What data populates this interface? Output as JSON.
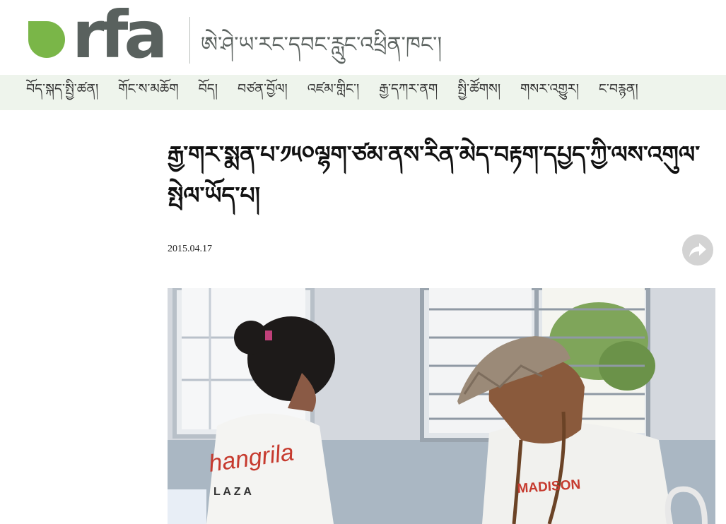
{
  "header": {
    "logo_text": "rfa",
    "service_name": "ཨེ་ཤེ་ཡ་རང་དབང་རླུང་འཕྲིན་ཁང་།"
  },
  "nav": {
    "items": [
      "བོད་སྐད་སྤྱི་ཚན།",
      "གོང་ས་མཆོག",
      "བོད།",
      "བཙན་བྱོལ།",
      "འཛམ་གླིང་།",
      "རྒྱ་དཀར་ནག",
      "སྤྱི་ཚོགས།",
      "གསར་འགྱུར།",
      "ང་བརྙན།"
    ]
  },
  "article": {
    "headline": "རྒྱ་གར་སྨན་པ་༡༥༠ལྷག་ཙམ་ནས་རིན་མེད་བརྟག་དཔྱད་ཀྱི་ལས་འགུལ་སྤེལ་ཡོད་པ།",
    "date": "2015.04.17",
    "photo_shirt_text_1": "hangrila",
    "photo_shirt_text_2": "L A Z A",
    "photo_shirt_text_3": "MADISON"
  },
  "icons": {
    "share": "share-arrow-icon"
  },
  "colors": {
    "brand_green": "#7ab648",
    "logo_gray": "#59615e",
    "nav_background": "#eef4ec",
    "share_gray": "#d3d3d3"
  }
}
